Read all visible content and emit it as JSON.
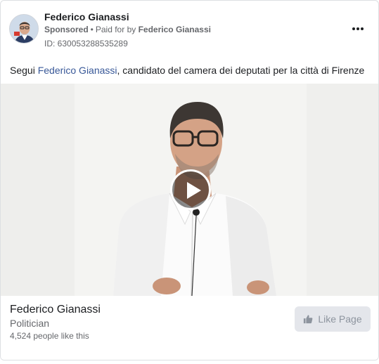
{
  "post": {
    "page_name": "Federico Gianassi",
    "sponsored_label": "Sponsored",
    "separator": "•",
    "paid_for_prefix": "Paid for by",
    "paid_for_name": "Federico Gianassi",
    "ad_id": "ID: 630053288535289",
    "more_icon": "more-options-icon",
    "text_before": "Segui ",
    "text_link": "Federico Gianassi",
    "text_after": ", candidato del camera dei deputati per la città di Firenze"
  },
  "video": {
    "play_icon": "play-icon"
  },
  "footer": {
    "page_name": "Federico Gianassi",
    "category": "Politician",
    "likes": "4,524 people like this",
    "like_button_label": "Like Page",
    "like_icon": "thumbs-up-icon"
  },
  "colors": {
    "link": "#385898",
    "secondary_text": "#65676b",
    "button_bg": "#e4e6eb"
  }
}
